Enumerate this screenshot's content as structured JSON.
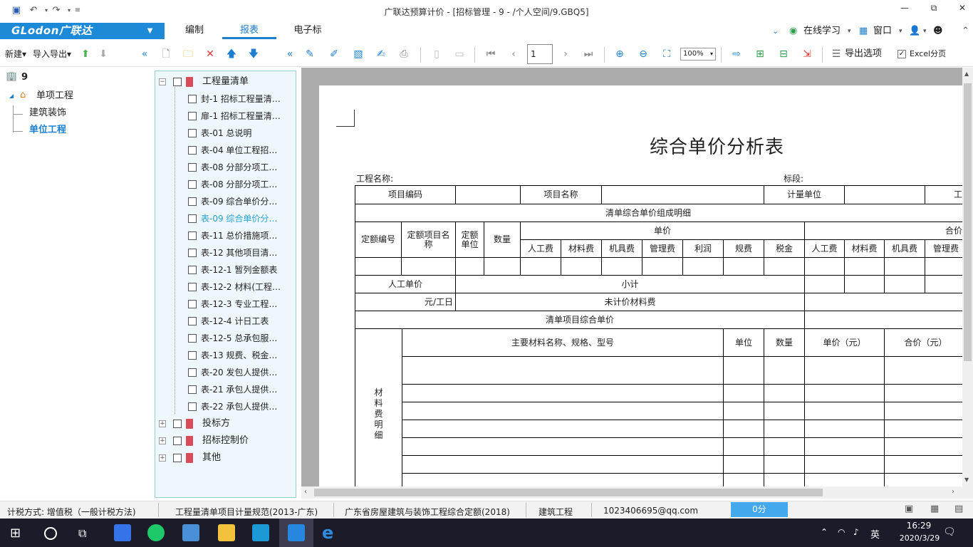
{
  "window": {
    "title": "广联达预算计价 - [招标管理 - 9 - /个人空间/9.GBQ5]",
    "controls": {
      "minimize": "—",
      "restore": "⧉",
      "close": "✕"
    }
  },
  "menubar": {
    "logo": "GLodon广联达",
    "tabs": [
      {
        "label": "编制",
        "active": false
      },
      {
        "label": "报表",
        "active": true
      },
      {
        "label": "电子标",
        "active": false
      }
    ],
    "right": {
      "online_learning": "在线学习",
      "window": "窗口"
    }
  },
  "toolbar": {
    "new_label": "新建",
    "import_export_label": "导入导出",
    "page_number": "1",
    "zoom": "100%",
    "export_options_label": "导出选项",
    "excel_paging_label": "Excel分页"
  },
  "left_panel": {
    "project": "9",
    "single_project": "单项工程",
    "items": [
      "建筑装饰",
      "单位工程"
    ],
    "selected": "单位工程"
  },
  "report_tree": {
    "groups": [
      {
        "label": "工程量清单",
        "expanded": true
      },
      {
        "label": "投标方",
        "expanded": false
      },
      {
        "label": "招标控制价",
        "expanded": false
      },
      {
        "label": "其他",
        "expanded": false
      }
    ],
    "items": [
      "封-1 招标工程量清…",
      "扉-1 招标工程量清…",
      "表-01 总说明",
      "表-04 单位工程招…",
      "表-08 分部分项工…",
      "表-08 分部分项工…",
      "表-09 综合单价分…",
      "表-09 综合单价分…",
      "表-11 总价措施项…",
      "表-12 其他项目清…",
      "表-12-1 暂列金额表",
      "表-12-2 材料(工程…",
      "表-12-3 专业工程…",
      "表-12-4 计日工表",
      "表-12-5 总承包服…",
      "表-13 规费、税金…",
      "表-20 发包人提供…",
      "表-21 承包人提供…",
      "表-22 承包人提供…"
    ],
    "selected_index": 7
  },
  "report": {
    "title": "综合单价分析表",
    "project_name_label": "工程名称:",
    "section_label": "标段:",
    "item_code": "项目编码",
    "item_name": "项目名称",
    "unit_of_measure": "计量单位",
    "quantity_cut": "工",
    "composition_detail": "清单综合单价组成明细",
    "quota_code": "定额编号",
    "quota_name": "定额项目名称",
    "quota_unit": "定额单位",
    "quantity": "数量",
    "unit_price": "单价",
    "total_price": "合价",
    "cost_cols": [
      "人工费",
      "材料费",
      "机具费",
      "管理费",
      "利润",
      "规费",
      "税金"
    ],
    "total_cols": [
      "人工费",
      "材料费",
      "机具费",
      "管理费"
    ],
    "labor_unit_price": "人工单价",
    "subtotal": "小计",
    "yuan_per_day": "元/工日",
    "unpriced_material": "未计价材料费",
    "list_unit_price": "清单项目综合单价",
    "material_detail": "材料费明细",
    "main_material": "主要材料名称、规格、型号",
    "unit": "单位",
    "mat_quantity": "数量",
    "mat_unit_price": "单价（元）",
    "mat_total": "合价（元）"
  },
  "status_bar": {
    "tax_method": "计税方式:  增值税（一般计税方法)",
    "spec": "工程量清单项目计量规范(2013-广东)",
    "quota": "广东省房屋建筑与装饰工程综合定额(2018)",
    "project_type": "建筑工程",
    "account": "1023406695@qq.com",
    "score": "0分"
  },
  "taskbar": {
    "time": "16:29",
    "date": "2020/3/29",
    "ime": "英"
  }
}
